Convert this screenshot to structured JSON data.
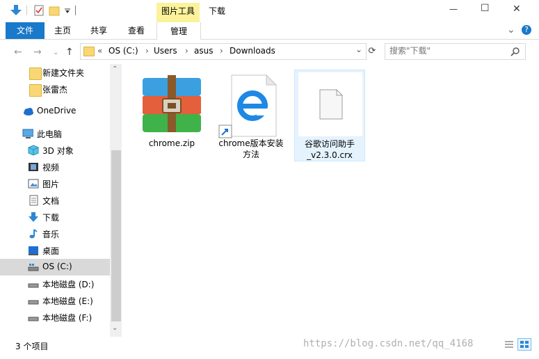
{
  "window": {
    "title": "下载",
    "minimize_glyph": "—",
    "maximize_glyph": "☐",
    "close_glyph": "✕",
    "help_glyph": "?",
    "collapse_glyph": "⌄"
  },
  "ribbon": {
    "context_title": "图片工具",
    "tabs": [
      {
        "label": "文件"
      },
      {
        "label": "主页"
      },
      {
        "label": "共享"
      },
      {
        "label": "查看"
      },
      {
        "label": "管理"
      }
    ]
  },
  "address": {
    "prefix": "«",
    "crumbs": [
      "OS (C:)",
      "Users",
      "asus",
      "Downloads"
    ],
    "sep": "›",
    "dropdown_glyph": "⌄",
    "refresh_glyph": "⟳"
  },
  "search": {
    "placeholder": "搜索\"下载\"",
    "icon": "search-icon"
  },
  "navpane": {
    "items": [
      {
        "label": "新建文件夹",
        "icon": "folder-icon"
      },
      {
        "label": "张雷杰",
        "icon": "folder-icon"
      },
      {
        "label": "OneDrive",
        "icon": "cloud-icon"
      },
      {
        "label": "此电脑",
        "icon": "computer-icon"
      },
      {
        "label": "3D 对象",
        "icon": "cube-icon"
      },
      {
        "label": "视频",
        "icon": "film-icon"
      },
      {
        "label": "图片",
        "icon": "picture-icon"
      },
      {
        "label": "文档",
        "icon": "document-icon"
      },
      {
        "label": "下载",
        "icon": "download-arrow-icon"
      },
      {
        "label": "音乐",
        "icon": "music-note-icon"
      },
      {
        "label": "桌面",
        "icon": "desktop-icon"
      },
      {
        "label": "OS (C:)",
        "icon": "drive-icon"
      },
      {
        "label": "本地磁盘 (D:)",
        "icon": "drive-icon"
      },
      {
        "label": "本地磁盘 (E:)",
        "icon": "drive-icon"
      },
      {
        "label": "本地磁盘 (F:)",
        "icon": "drive-icon"
      }
    ],
    "selected": "OS (C:)",
    "scroll_up_glyph": "⌃",
    "scroll_down_glyph": "⌄"
  },
  "files": [
    {
      "name": "chrome.zip",
      "icon": "winrar-archive-icon"
    },
    {
      "name": "chrome版本安装方法",
      "icon": "edge-shortcut-icon"
    },
    {
      "name": "谷歌访问助手_v2.3.0.crx",
      "icon": "blank-file-icon"
    }
  ],
  "status": {
    "item_count": "3 个项目"
  },
  "watermark": "https://blog.csdn.net/qq_4168",
  "colors": {
    "accent": "#1979ca",
    "context_tab": "#fbf29b",
    "selection_bg": "#cce8ff",
    "selection_border": "#99d1ff",
    "nav_selected": "#d9d9d9"
  }
}
